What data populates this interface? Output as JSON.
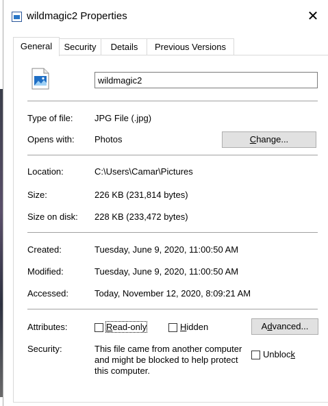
{
  "window": {
    "title": "wildmagic2 Properties",
    "close_glyph": "✕"
  },
  "tabs": [
    {
      "label": "General",
      "active": true
    },
    {
      "label": "Security",
      "active": false
    },
    {
      "label": "Details",
      "active": false
    },
    {
      "label": "Previous Versions",
      "active": false
    }
  ],
  "general": {
    "file_name": "wildmagic2",
    "type_of_file": {
      "label": "Type of file:",
      "value": "JPG File (.jpg)"
    },
    "opens_with": {
      "label": "Opens with:",
      "value": "Photos",
      "button_pre": "",
      "button_u": "C",
      "button_post": "hange..."
    },
    "location": {
      "label": "Location:",
      "value": "C:\\Users\\Camar\\Pictures"
    },
    "size": {
      "label": "Size:",
      "value": "226 KB (231,814 bytes)"
    },
    "size_on_disk": {
      "label": "Size on disk:",
      "value": "228 KB (233,472 bytes)"
    },
    "created": {
      "label": "Created:",
      "value": "Tuesday, June 9, 2020, 11:00:50 AM"
    },
    "modified": {
      "label": "Modified:",
      "value": "Tuesday, June 9, 2020, 11:00:50 AM"
    },
    "accessed": {
      "label": "Accessed:",
      "value": "Today, November 12, 2020, 8:09:21 AM"
    },
    "attributes": {
      "label": "Attributes:",
      "read_only_u": "R",
      "read_only_rest": "ead-only",
      "read_only_checked": false,
      "hidden_u": "H",
      "hidden_rest": "idden",
      "hidden_checked": false,
      "advanced_pre": "A",
      "advanced_u": "d",
      "advanced_post": "vanced..."
    },
    "security": {
      "label": "Security:",
      "message_line1": "This file came from another computer",
      "message_line2": "and might be blocked to help protect",
      "message_line3": "this computer.",
      "unblock_pre": "Unbloc",
      "unblock_u": "k",
      "unblock_checked": false
    }
  },
  "icons": {
    "title": "image-file-icon",
    "file": "jpg-file-icon",
    "close": "close-icon"
  }
}
